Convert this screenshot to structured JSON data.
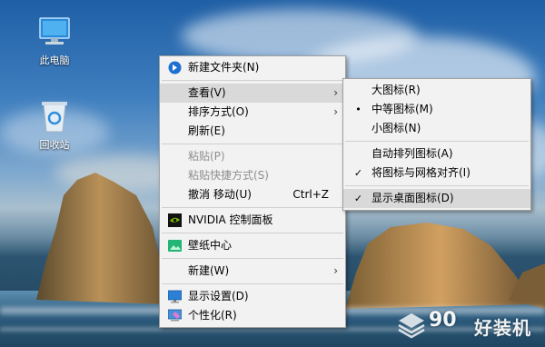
{
  "desktop": {
    "icons": [
      {
        "label": "此电脑",
        "icon": "computer-icon"
      },
      {
        "label": "回收站",
        "icon": "recycle-bin-icon"
      }
    ],
    "watermark": {
      "number": "90",
      "text": "好装机"
    }
  },
  "context_menu": {
    "items": [
      {
        "label": "新建文件夹(N)",
        "icon": "new-folder-icon"
      },
      {
        "label": "查看(V)",
        "has_submenu": true,
        "highlighted": true
      },
      {
        "label": "排序方式(O)",
        "has_submenu": true
      },
      {
        "label": "刷新(E)"
      },
      {
        "label": "粘贴(P)",
        "disabled": true
      },
      {
        "label": "粘贴快捷方式(S)",
        "disabled": true
      },
      {
        "label": "撤消 移动(U)",
        "shortcut": "Ctrl+Z"
      },
      {
        "label": "NVIDIA 控制面板",
        "icon": "nvidia-icon"
      },
      {
        "label": "壁纸中心",
        "icon": "wallpaper-center-icon"
      },
      {
        "label": "新建(W)",
        "has_submenu": true
      },
      {
        "label": "显示设置(D)",
        "icon": "display-settings-icon"
      },
      {
        "label": "个性化(R)",
        "icon": "personalize-icon"
      }
    ],
    "arrow_glyph": "›"
  },
  "view_submenu": {
    "items": [
      {
        "label": "大图标(R)"
      },
      {
        "label": "中等图标(M)",
        "mark": "•"
      },
      {
        "label": "小图标(N)"
      },
      {
        "label": "自动排列图标(A)"
      },
      {
        "label": "将图标与网格对齐(I)",
        "mark": "✓"
      },
      {
        "label": "显示桌面图标(D)",
        "mark": "✓",
        "highlighted": true
      }
    ]
  },
  "colors": {
    "menu_bg": "#f2f2f2",
    "menu_highlight": "#d9d9d9",
    "disabled_text": "#8e8e8e",
    "nvidia_green": "#76b900"
  }
}
